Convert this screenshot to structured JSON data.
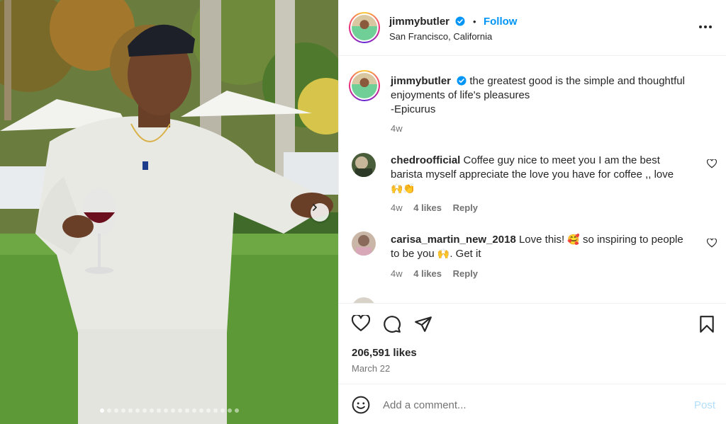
{
  "post": {
    "username": "jimmybutler",
    "follow_label": "Follow",
    "separator": "•",
    "location": "San Francisco, California",
    "more_label": "•••"
  },
  "caption": {
    "username": "jimmybutler",
    "line1": "the greatest good is the simple and thoughtful",
    "line2": "enjoyments of life's pleasures",
    "line3": "-Epicurus",
    "time": "4w"
  },
  "comments": [
    {
      "username": "chedroofficial",
      "line1": "Coffee guy nice to meet you I am the best",
      "line2": "barista myself appreciate the love you have for coffee ,, love",
      "emoji": "🙌👏",
      "time": "4w",
      "likes": "4 likes",
      "reply": "Reply"
    },
    {
      "username": "carisa_martin_new_2018",
      "line1_text": "Love this!",
      "line1_emoji": "🥰",
      "line1_rest": "so inspiring to people",
      "line2_text": "to be you",
      "line2_emoji": "🙌",
      "line2_rest": ". Get it",
      "time": "4w",
      "likes": "4 likes",
      "reply": "Reply"
    }
  ],
  "engagement": {
    "likes": "206,591 likes",
    "date": "March 22"
  },
  "composer": {
    "placeholder": "Add a comment...",
    "post_label": "Post"
  },
  "carousel": {
    "total": 20,
    "active_index": 0
  },
  "colors": {
    "link": "#0095f6",
    "muted": "#737373",
    "post_disabled": "#b2dffc"
  }
}
